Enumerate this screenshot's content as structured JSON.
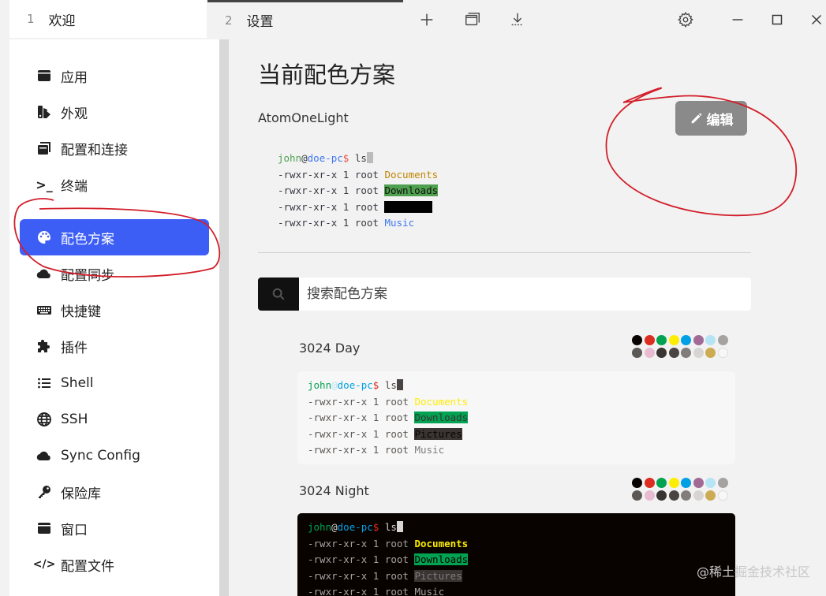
{
  "tabs": [
    {
      "number": "1",
      "label": "欢迎"
    },
    {
      "number": "2",
      "label": "设置"
    }
  ],
  "toolbar_icons": [
    "plus-icon",
    "window-icon",
    "download-icon",
    "gear-icon",
    "minimize-icon",
    "maximize-icon",
    "close-icon"
  ],
  "sidebar": {
    "items": [
      {
        "label": "应用",
        "icon": "app-icon"
      },
      {
        "label": "外观",
        "icon": "palette-brush-icon"
      },
      {
        "label": "配置和连接",
        "icon": "profiles-icon"
      },
      {
        "label": "终端",
        "icon": "terminal-icon",
        "glyph": ">_"
      },
      {
        "label": "配色方案",
        "icon": "palette-icon",
        "active": true
      },
      {
        "label": "配置同步",
        "icon": "cloud-icon"
      },
      {
        "label": "快捷键",
        "icon": "keyboard-icon"
      },
      {
        "label": "插件",
        "icon": "puzzle-icon"
      },
      {
        "label": "Shell",
        "icon": "list-icon"
      },
      {
        "label": "SSH",
        "icon": "globe-icon"
      },
      {
        "label": "Sync Config",
        "icon": "cloud-icon"
      },
      {
        "label": "保险库",
        "icon": "key-icon"
      },
      {
        "label": "窗口",
        "icon": "window-icon"
      },
      {
        "label": "配置文件",
        "icon": "code-icon",
        "glyph": "</>"
      }
    ]
  },
  "main": {
    "title": "当前配色方案",
    "current_scheme": "AtomOneLight",
    "edit_label": "编辑",
    "search_placeholder": "搜索配色方案"
  },
  "terminal_sample": {
    "user": "john",
    "at": "@",
    "host": "doe-pc",
    "prompt": "$",
    "command": "ls",
    "perm": "-rwxr-xr-x 1 root",
    "entries": [
      "Documents",
      "Downloads",
      "Pictures",
      "Music"
    ]
  },
  "colors": {
    "accent": "#3d5ef5",
    "annotation": "#d21f2a",
    "atom_user": "#50a14f",
    "atom_host": "#4078f2",
    "atom_prompt": "#e45649",
    "atom_dir_doc": "#c18401",
    "atom_dir_dl_bg": "#50a14f",
    "atom_music": "#4078f2"
  },
  "schemes": [
    {
      "name": "3024 Day",
      "swatches_top": [
        "#090300",
        "#db2d20",
        "#01a252",
        "#fded02",
        "#01a0e4",
        "#a16a94",
        "#b5e4f4",
        "#a5a2a2"
      ],
      "swatches_bottom": [
        "#5c5855",
        "#e8bbd0",
        "#3a3432",
        "#4a4543",
        "#807d7c",
        "#d6d5d4",
        "#cdab53",
        "#f7f7f7"
      ]
    },
    {
      "name": "3024 Night",
      "swatches_top": [
        "#090300",
        "#db2d20",
        "#01a252",
        "#fded02",
        "#01a0e4",
        "#a16a94",
        "#b5e4f4",
        "#a5a2a2"
      ],
      "swatches_bottom": [
        "#5c5855",
        "#e8bbd0",
        "#3a3432",
        "#4a4543",
        "#807d7c",
        "#d6d5d4",
        "#cdab53",
        "#f7f7f7"
      ]
    }
  ],
  "watermark": "@稀土掘金技术社区"
}
